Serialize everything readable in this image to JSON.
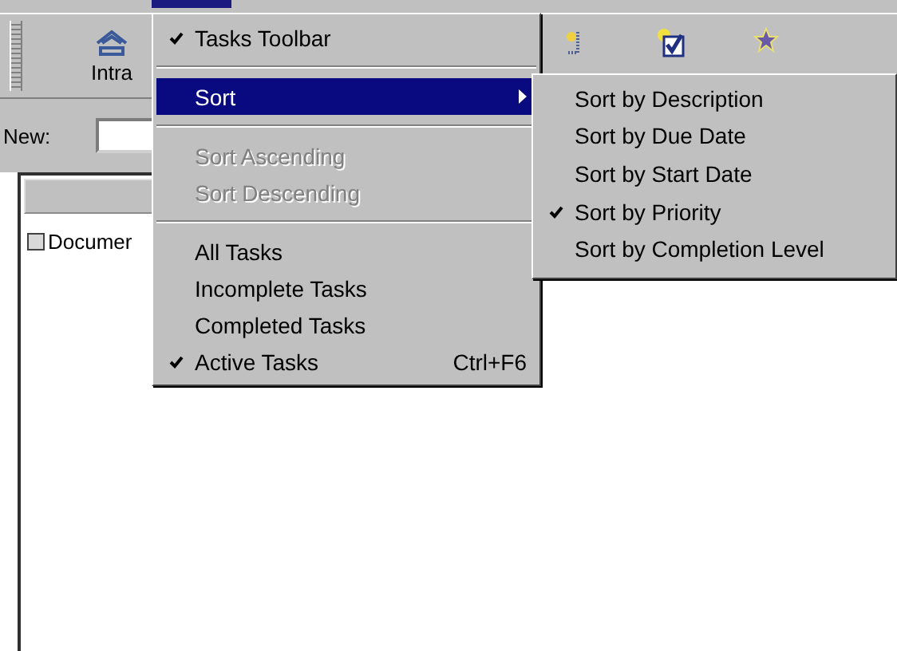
{
  "menu_bar": {
    "active_title_highlighted": true
  },
  "toolbar": {
    "buttons": [
      {
        "kind": "house",
        "label": "Intra"
      },
      {
        "kind": "new-item"
      },
      {
        "kind": "check"
      },
      {
        "kind": "star"
      }
    ]
  },
  "new_row": {
    "label": "New:"
  },
  "task_list": {
    "items": [
      {
        "label": "Documer",
        "checked": false
      }
    ]
  },
  "context_menu": {
    "items": [
      {
        "kind": "item",
        "label": "Tasks Toolbar",
        "checked": true,
        "disabled": false,
        "selected": false
      },
      {
        "kind": "separator"
      },
      {
        "kind": "submenu",
        "label": "Sort",
        "checked": false,
        "disabled": false,
        "selected": true
      },
      {
        "kind": "separator"
      },
      {
        "kind": "item",
        "label": "Sort Ascending",
        "checked": false,
        "disabled": true,
        "selected": false
      },
      {
        "kind": "item",
        "label": "Sort Descending",
        "checked": false,
        "disabled": true,
        "selected": false
      },
      {
        "kind": "separator"
      },
      {
        "kind": "item",
        "label": "All Tasks",
        "checked": false,
        "disabled": false,
        "selected": false
      },
      {
        "kind": "item",
        "label": "Incomplete Tasks",
        "checked": false,
        "disabled": false,
        "selected": false
      },
      {
        "kind": "item",
        "label": "Completed Tasks",
        "checked": false,
        "disabled": false,
        "selected": false
      },
      {
        "kind": "item",
        "label": "Active Tasks",
        "checked": true,
        "disabled": false,
        "selected": false,
        "shortcut": "Ctrl+F6"
      }
    ]
  },
  "sort_submenu": {
    "items": [
      {
        "label": "Sort by Description",
        "checked": false
      },
      {
        "label": "Sort by Due Date",
        "checked": false
      },
      {
        "label": "Sort by Start Date",
        "checked": false
      },
      {
        "label": "Sort by Priority",
        "checked": true
      },
      {
        "label": "Sort by Completion Level",
        "checked": false
      }
    ]
  }
}
